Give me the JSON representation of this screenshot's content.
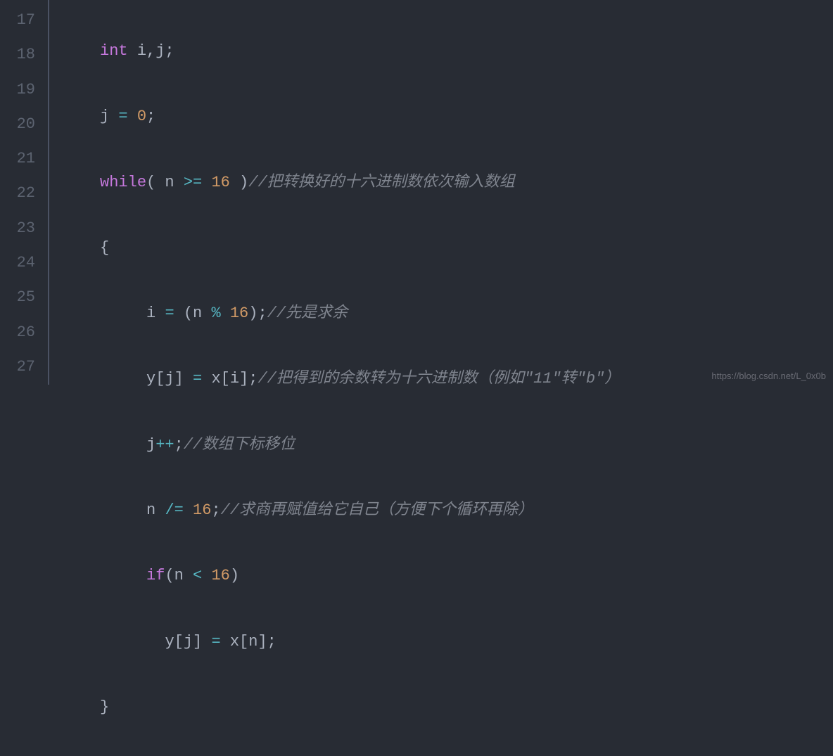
{
  "gutter": {
    "lines": [
      "17",
      "18",
      "19",
      "20",
      "21",
      "22",
      "23",
      "24",
      "25",
      "26",
      "27"
    ]
  },
  "code": {
    "l17": {
      "kw": "int",
      "rest": " i,j;"
    },
    "l18": {
      "pre": "j ",
      "op": "=",
      "mid": " ",
      "num": "0",
      "semi": ";"
    },
    "l19": {
      "kw": "while",
      "open": "( n ",
      "op": ">=",
      "mid": " ",
      "num": "16",
      "close": " )",
      "comment": "//把转换好的十六进制数依次输入数组"
    },
    "l20": {
      "brace": "{"
    },
    "l21": {
      "pre": "i ",
      "op1": "=",
      "mid1": " (n ",
      "op2": "%",
      "mid2": " ",
      "num": "16",
      "close": ");",
      "comment": "//先是求余"
    },
    "l22": {
      "text": "y[j] ",
      "op": "=",
      "mid": " x[i];",
      "comment": "//把得到的余数转为十六进制数（例如\"11\"转\"b\"）"
    },
    "l23": {
      "pre": "j",
      "op": "++",
      "semi": ";",
      "comment": "//数组下标移位"
    },
    "l24": {
      "pre": "n ",
      "op": "/=",
      "mid": " ",
      "num": "16",
      "semi": ";",
      "comment": "//求商再赋值给它自己（方便下个循环再除）"
    },
    "l25": {
      "kw": "if",
      "open": "(n ",
      "op": "<",
      "mid": " ",
      "num": "16",
      "close": ")"
    },
    "l26": {
      "text": "y[j] ",
      "op": "=",
      "rest": " x[n];"
    },
    "l27": {
      "brace": "}"
    }
  },
  "watermark": "https://blog.csdn.net/L_0x0b"
}
